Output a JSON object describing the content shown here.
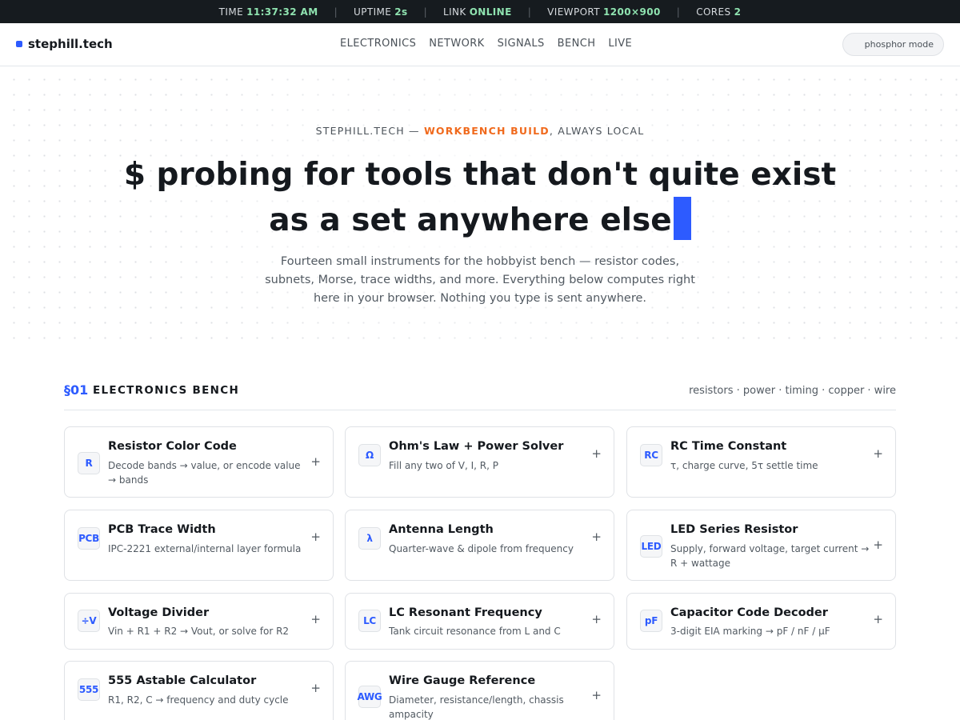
{
  "statusbar": {
    "time_label": "TIME",
    "time_value": "11:37:32 AM",
    "uptime_label": "UPTIME",
    "uptime_value": "2s",
    "link_label": "LINK",
    "link_value": "ONLINE",
    "viewport_label": "VIEWPORT",
    "viewport_value": "1200×900",
    "cores_label": "CORES",
    "cores_value": "2",
    "separator": "|"
  },
  "nav": {
    "brand": "stephill.tech",
    "links": [
      "ELECTRONICS",
      "NETWORK",
      "SIGNALS",
      "BENCH",
      "LIVE"
    ],
    "mode_button": "phosphor mode"
  },
  "hero": {
    "eyebrow_prefix": "STEPHILL.TECH — ",
    "eyebrow_accent": "WORKBENCH BUILD",
    "eyebrow_suffix": ", ALWAYS LOCAL",
    "headline_line1": "$ probing for tools that don't quite exist",
    "headline_line2": "as a set anywhere else",
    "subline": "Fourteen small instruments for the hobbyist bench — resistor codes, subnets, Morse, trace widths, and more. Everything below computes right here in your browser. Nothing you type is sent anywhere."
  },
  "section": {
    "number": "§01",
    "title": "ELECTRONICS BENCH",
    "tags": "resistors · power · timing · copper · wire"
  },
  "colors": {
    "accent_blue": "#2d5bff",
    "accent_orange": "#f06a1d",
    "status_value_green": "#8fe3b0",
    "statusbar_bg": "#161b1f"
  },
  "tools": [
    {
      "icon": "R",
      "title": "Resistor Color Code",
      "desc": "Decode bands → value, or encode value → bands",
      "action": "+"
    },
    {
      "icon": "Ω",
      "title": "Ohm's Law + Power Solver",
      "desc": "Fill any two of V, I, R, P",
      "action": "+"
    },
    {
      "icon": "RC",
      "title": "RC Time Constant",
      "desc": "τ, charge curve, 5τ settle time",
      "action": "+"
    },
    {
      "icon": "PCB",
      "title": "PCB Trace Width",
      "desc": "IPC-2221 external/internal layer formula",
      "action": "+"
    },
    {
      "icon": "λ",
      "title": "Antenna Length",
      "desc": "Quarter-wave & dipole from frequency",
      "action": "+"
    },
    {
      "icon": "LED",
      "title": "LED Series Resistor",
      "desc": "Supply, forward voltage, target current → R + wattage",
      "action": "+"
    },
    {
      "icon": "÷V",
      "title": "Voltage Divider",
      "desc": "Vin + R1 + R2 → Vout, or solve for R2",
      "action": "+"
    },
    {
      "icon": "LC",
      "title": "LC Resonant Frequency",
      "desc": "Tank circuit resonance from L and C",
      "action": "+"
    },
    {
      "icon": "pF",
      "title": "Capacitor Code Decoder",
      "desc": "3-digit EIA marking → pF / nF / µF",
      "action": "+"
    },
    {
      "icon": "555",
      "title": "555 Astable Calculator",
      "desc": "R1, R2, C → frequency and duty cycle",
      "action": "+"
    },
    {
      "icon": "AWG",
      "title": "Wire Gauge Reference",
      "desc": "Diameter, resistance/length, chassis ampacity",
      "action": "+"
    }
  ]
}
